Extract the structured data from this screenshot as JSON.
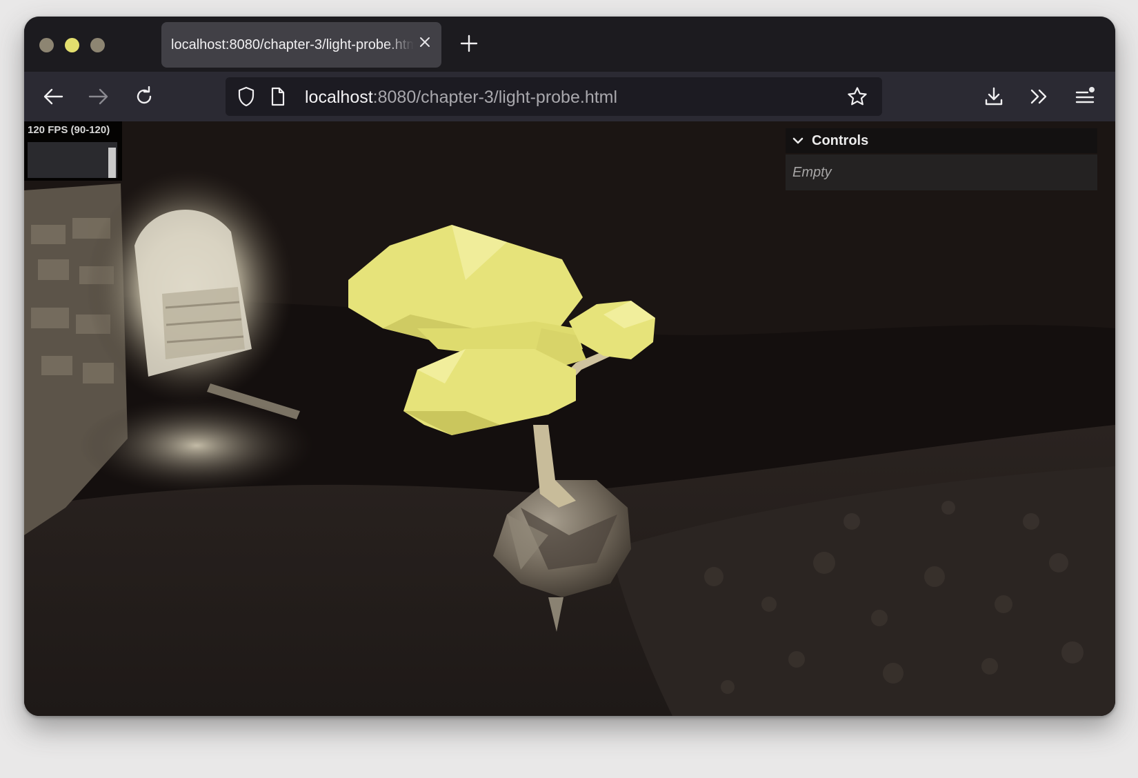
{
  "browser": {
    "tab": {
      "title": "localhost:8080/chapter-3/light-probe.html"
    },
    "url": {
      "host": "localhost",
      "rest": ":8080/chapter-3/light-probe.html"
    }
  },
  "stats": {
    "fps_label": "120 FPS (90-120)",
    "fps_level": 0.85
  },
  "controls": {
    "title": "Controls",
    "empty_label": "Empty"
  },
  "colors": {
    "accent_yellow": "#e3df6e",
    "toolbar": "#2b2a33",
    "tabstrip": "#1c1b1f"
  }
}
